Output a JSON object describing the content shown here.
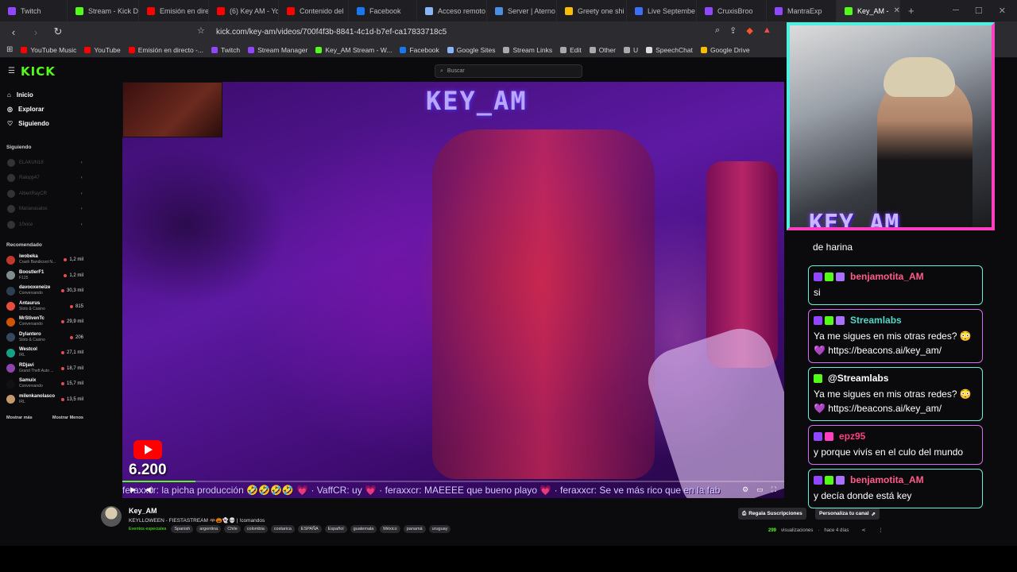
{
  "browser": {
    "tabs": [
      {
        "label": "Twitch",
        "color": "#9146ff"
      },
      {
        "label": "Stream - Kick D",
        "color": "#53fc18"
      },
      {
        "label": "Emisión en dire",
        "color": "#ff0000"
      },
      {
        "label": "(6) Key AM - Yo",
        "color": "#ff0000"
      },
      {
        "label": "Contenido del",
        "color": "#ff0000"
      },
      {
        "label": "Facebook",
        "color": "#1877f2"
      },
      {
        "label": "Acceso remoto",
        "color": "#8ab4f8"
      },
      {
        "label": "Server | Aterno",
        "color": "#4a90e2"
      },
      {
        "label": "Greety one shi",
        "color": "#fbbc04"
      },
      {
        "label": "Live Septembe",
        "color": "#3a6ff7"
      },
      {
        "label": "CruxisBroo",
        "color": "#9146ff"
      },
      {
        "label": "MantraExp",
        "color": "#9146ff"
      },
      {
        "label": "Key_AM - ",
        "color": "#53fc18",
        "active": true
      }
    ],
    "url": "kick.com/key-am/videos/700f4f3b-8841-4c1d-b7ef-ca17833718c5",
    "bookmarks": [
      {
        "label": "YouTube Music",
        "color": "#ff0000"
      },
      {
        "label": "YouTube",
        "color": "#ff0000"
      },
      {
        "label": "Emisión en directo -...",
        "color": "#ff0000"
      },
      {
        "label": "Twitch",
        "color": "#9146ff"
      },
      {
        "label": "Stream Manager",
        "color": "#9146ff"
      },
      {
        "label": "Key_AM Stream - W...",
        "color": "#53fc18"
      },
      {
        "label": "Facebook",
        "color": "#1877f2"
      },
      {
        "label": "Google Sites",
        "color": "#8ab4f8"
      },
      {
        "label": "Stream Links",
        "color": "#aaaaaa"
      },
      {
        "label": "Edit",
        "color": "#aaaaaa"
      },
      {
        "label": "Other",
        "color": "#aaaaaa"
      },
      {
        "label": "U",
        "color": "#aaaaaa"
      },
      {
        "label": "SpeechChat",
        "color": "#dddddd"
      },
      {
        "label": "Google Drive",
        "color": "#fbbc04"
      }
    ]
  },
  "kick": {
    "logo": "KICK",
    "search_placeholder": "Buscar",
    "nav": [
      "Inicio",
      "Explorar",
      "Siguiendo"
    ],
    "following_title": "Siguiendo",
    "following": [
      "ELAKUN18",
      "Ralopp47",
      "AlbertRayCR",
      "Marianasalos",
      "10vice"
    ],
    "recommended_title": "Recomendado",
    "recommended": [
      {
        "name": "iwobeka",
        "category": "Crash Bandicoot N...",
        "viewers": "1,2 mil",
        "color": "#c0392b"
      },
      {
        "name": "BoostlerF1",
        "category": "F125",
        "viewers": "1,2 mil",
        "color": "#7f8c8d"
      },
      {
        "name": "davooxeneize",
        "category": "Conversando",
        "viewers": "30,3 mil",
        "color": "#2c3e50"
      },
      {
        "name": "Antaurus",
        "category": "Slots & Casino",
        "viewers": "815",
        "color": "#e74c3c"
      },
      {
        "name": "MrStivenTc",
        "category": "Conversando",
        "viewers": "29,9 mil",
        "color": "#d35400"
      },
      {
        "name": "Dylantero",
        "category": "Slots & Casino",
        "viewers": "206",
        "color": "#34495e"
      },
      {
        "name": "Westcol",
        "category": "IRL",
        "viewers": "27,1 mil",
        "color": "#16a085"
      },
      {
        "name": "RDjavi",
        "category": "Grand Theft Auto ...",
        "viewers": "18,7 mil",
        "color": "#8e44ad"
      },
      {
        "name": "Samuix",
        "category": "Conversando",
        "viewers": "15,7 mil",
        "color": "#111111"
      },
      {
        "name": "milenkanolasco",
        "category": "IRL",
        "viewers": "13,5 mil",
        "color": "#c49a6c"
      }
    ],
    "show_more": "Mostrar más",
    "show_less": "Mostrar Menos"
  },
  "video": {
    "overlay_logo": "KEY_AM",
    "yt_count": "6.200",
    "progress": 0.11,
    "ticker": "feraxxcr: la picha producción 🤣🤣🤣🤣 💗 · VaffCR: uy 💗 · feraxxcr: MAEEEE que bueno playo 💗 · feraxxcr: Se ve más rico que en la fab"
  },
  "webcam": {
    "logo": "KEY_AM"
  },
  "chat": {
    "fragment": "de harina",
    "messages": [
      {
        "user": "benjamotita_AM",
        "color": "#ff5c8a",
        "text": "si",
        "border": "b1",
        "badges": [
          "#9146ff",
          "#53fc18",
          "#a970ff"
        ]
      },
      {
        "user": "Streamlabs",
        "color": "#53d8c7",
        "text": "Ya me sigues en mis otras redes? 😳 💜 https://beacons.ai/key_am/",
        "border": "b2",
        "badges": [
          "#9146ff",
          "#53fc18",
          "#a970ff"
        ]
      },
      {
        "user": "@Streamlabs",
        "color": "#ffffff",
        "text": "Ya me sigues en mis otras redes? 😳 💜 https://beacons.ai/key_am/",
        "border": "b1",
        "badges": [
          "#53fc18"
        ]
      },
      {
        "user": "epz95",
        "color": "#ff3f7f",
        "text": "y porque vivís en el culo del mundo",
        "border": "b2",
        "badges": [
          "#9146ff",
          "#ff3fbf"
        ]
      },
      {
        "user": "benjamotita_AM",
        "color": "#ff5c8a",
        "text": "y decía donde está key",
        "border": "b1",
        "badges": [
          "#9146ff",
          "#53fc18",
          "#a970ff"
        ]
      }
    ]
  },
  "info": {
    "channel": "Key_AM",
    "title": "KEYLLOWEEN - FIESTASTREAM 🦇🎃👻💀 | !comandos",
    "category": "Eventos especiales",
    "tags": [
      "Spanish",
      "argentina",
      "Chile",
      "colombia",
      "costarica",
      "ESPAÑA",
      "Español",
      "guatemala",
      "México",
      "panamá",
      "uruguay"
    ],
    "gift_subs": "Regala Suscripciones",
    "customize": "Personaliza tu canal",
    "views": "299",
    "views_label": "visualizaciones",
    "age": "hace 4 días"
  }
}
